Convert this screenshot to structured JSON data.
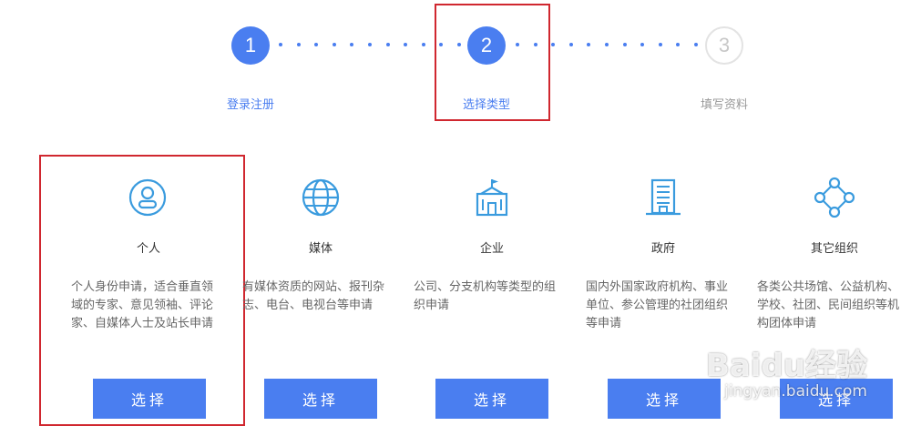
{
  "stepper": {
    "steps": [
      {
        "number": "1",
        "label": "登录注册",
        "state": "completed"
      },
      {
        "number": "2",
        "label": "选择类型",
        "state": "current"
      },
      {
        "number": "3",
        "label": "填写资料",
        "state": "pending"
      }
    ],
    "active_color": "#4a7ef0",
    "inactive_color": "#c8c8c8"
  },
  "types": [
    {
      "icon": "user-circle-icon",
      "title": "个人",
      "desc": [
        "个人身份申请，适合垂直领",
        "域的专家、意见领袖、评论",
        "家、自媒体人士及站长申请"
      ],
      "button": "选择"
    },
    {
      "icon": "globe-icon",
      "title": "媒体",
      "desc": [
        "有媒体资质的网站、报刊杂",
        "志、电台、电视台等申请"
      ],
      "button": "选择"
    },
    {
      "icon": "enterprise-building-icon",
      "title": "企业",
      "desc": [
        "公司、分支机构等类型的组",
        "织申请"
      ],
      "button": "选择"
    },
    {
      "icon": "government-building-icon",
      "title": "政府",
      "desc": [
        "国内外国家政府机构、事业",
        "单位、参公管理的社团组织",
        "等申请"
      ],
      "button": "选择"
    },
    {
      "icon": "network-nodes-icon",
      "title": "其它组织",
      "desc": [
        "各类公共场馆、公益机构、",
        "学校、社团、民间组织等机",
        "构团体申请"
      ],
      "button": "选择"
    }
  ],
  "watermark": {
    "brand": "Baidu经验",
    "url": "jingyan.baidu.com"
  },
  "highlight_color": "#d0272f"
}
